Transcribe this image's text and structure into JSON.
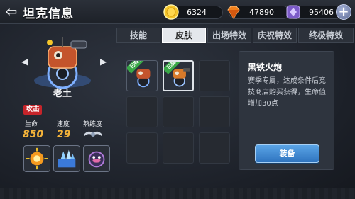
{
  "header": {
    "back_icon": "back-arrow-icon",
    "title": "坦克信息",
    "resources": [
      {
        "name": "gold",
        "icon": "gold-coin-icon",
        "value": "6324",
        "color": "#f5c62a"
      },
      {
        "name": "diamond",
        "icon": "orange-gem-icon",
        "value": "47890",
        "color": "#f07f1c"
      },
      {
        "name": "crystal",
        "icon": "purple-crystal-icon",
        "value": "95406",
        "color": "#8d6bd6"
      }
    ],
    "add_label": "+"
  },
  "tank": {
    "name": "老土",
    "type_tag": "攻击",
    "stats": [
      {
        "label": "生命",
        "value": "850"
      },
      {
        "label": "速度",
        "value": "29"
      },
      {
        "label": "熟练度",
        "value": ""
      }
    ],
    "skills": [
      "fireball-icon",
      "ice-crystal-icon",
      "dark-orb-icon"
    ]
  },
  "tabs": [
    {
      "label": "技能",
      "active": false
    },
    {
      "label": "皮肤",
      "active": true
    },
    {
      "label": "出场特效",
      "active": false
    },
    {
      "label": "庆祝特效",
      "active": false
    },
    {
      "label": "终极特效",
      "active": false
    }
  ],
  "skins": [
    {
      "ribbon": "已拥有",
      "selected": false
    },
    {
      "ribbon": "已装备",
      "selected": true
    }
  ],
  "skin_info": {
    "title": "黑铁火炮",
    "description": "赛季专属，达成条件后竞技商店购买获得，生命值增加30点",
    "equip_label": "装备"
  }
}
